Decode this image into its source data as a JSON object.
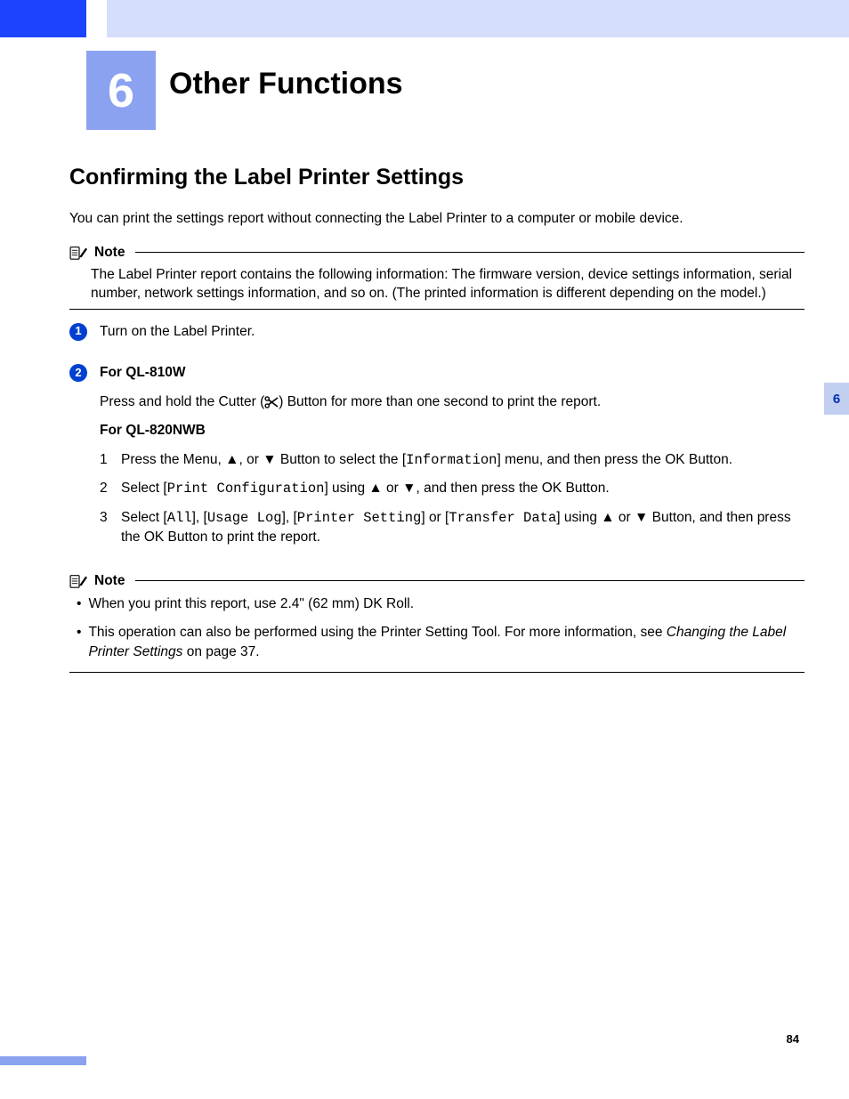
{
  "chapter": {
    "number": "6",
    "title": "Other Functions"
  },
  "sideTab": "6",
  "pageNumber": "84",
  "section": {
    "title": "Confirming the Label Printer Settings",
    "intro": "You can print the settings report without connecting the Label Printer to a computer or mobile device."
  },
  "note1": {
    "label": "Note",
    "body": "The Label Printer report contains the following information: The firmware version, device settings information, serial number, network settings information, and so on. (The printed information is different depending on the model.)"
  },
  "steps": {
    "s1": {
      "text": "Turn on the Label Printer."
    },
    "s2": {
      "modelA_label": "For QL-810W",
      "modelA_pre": "Press and hold the Cutter (",
      "modelA_post": ") Button for more than one second to print the report.",
      "modelB_label": "For QL-820NWB",
      "sub1_pre": "Press the Menu, ▲, or ▼ Button to select the [",
      "sub1_mono": "Information",
      "sub1_post": "] menu, and then press the OK Button.",
      "sub2_pre": "Select [",
      "sub2_mono": "Print Configuration",
      "sub2_post": "] using ▲ or ▼, and then press the OK Button.",
      "sub3_pre": "Select [",
      "sub3_m1": "All",
      "sub3_t1": "], [",
      "sub3_m2": "Usage Log",
      "sub3_t2": "], [",
      "sub3_m3": "Printer Setting",
      "sub3_t3": "] or [",
      "sub3_m4": "Transfer Data",
      "sub3_post": "] using ▲ or ▼ Button, and then press the OK Button to print the report."
    }
  },
  "note2": {
    "label": "Note",
    "b1": "When you print this report, use 2.4\" (62 mm) DK Roll.",
    "b2_pre": "This operation can also be performed using the Printer Setting Tool. For more information, see ",
    "b2_italic": "Changing the Label Printer Settings",
    "b2_post": " on page 37."
  }
}
